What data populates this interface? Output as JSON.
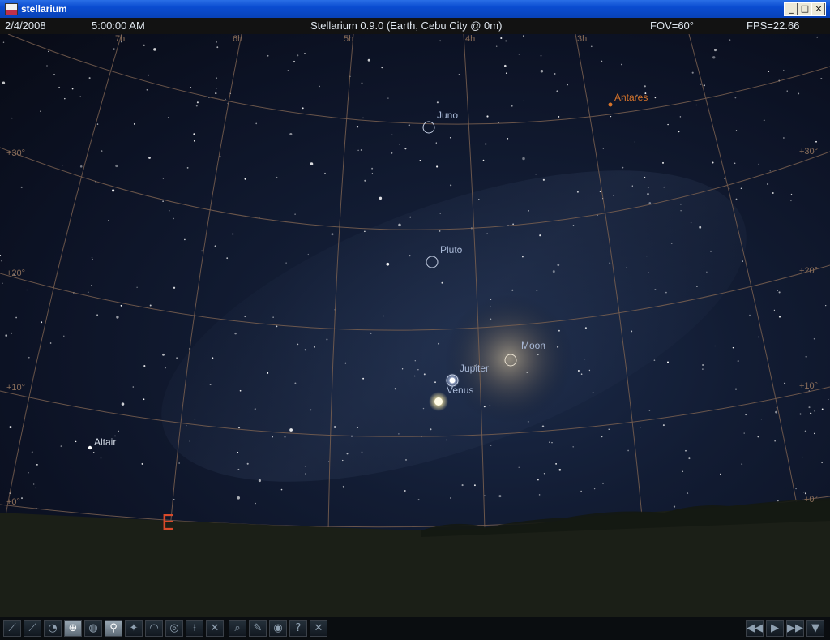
{
  "window": {
    "title": "stellarium"
  },
  "status": {
    "date": "2/4/2008",
    "time": "5:00:00 AM",
    "location": "Stellarium 0.9.0 (Earth, Cebu City @ 0m)",
    "fov": "FOV=60°",
    "fps": "FPS=22.66"
  },
  "sky": {
    "objects": {
      "juno": "Juno",
      "antares": "Antares",
      "pluto": "Pluto",
      "moon": "Moon",
      "jupiter": "Jupiter",
      "venus": "Venus",
      "altair": "Altair"
    },
    "cardinal_east": "E",
    "grid_labels": {
      "alt30_left": "+30°",
      "alt30_right": "+30°",
      "alt20_left": "+20°",
      "alt20_right": "+20°",
      "alt10_left": "+10°",
      "alt10_right": "+10°",
      "alt0_left": "+0°",
      "alt0_right": "+0°",
      "ra7": "7h",
      "ra6": "6h",
      "ra5": "5h",
      "ra4": "4h",
      "ra3": "3h"
    }
  },
  "toolbar": {
    "left": [
      {
        "name": "constellation-lines-button",
        "icon": "constellation-lines-icon",
        "glyph": "⟋"
      },
      {
        "name": "constellation-names-button",
        "icon": "constellation-names-icon",
        "glyph": "⟋"
      },
      {
        "name": "constellation-art-button",
        "icon": "constellation-art-icon",
        "glyph": "◔"
      },
      {
        "name": "equatorial-grid-button",
        "icon": "equatorial-grid-icon",
        "glyph": "⊕"
      },
      {
        "name": "azimuthal-grid-button",
        "icon": "azimuthal-grid-icon",
        "glyph": "◍"
      },
      {
        "name": "ground-button",
        "icon": "ground-icon",
        "glyph": "⚲"
      },
      {
        "name": "cardinal-points-button",
        "icon": "cardinal-points-icon",
        "glyph": "✦"
      },
      {
        "name": "atmosphere-button",
        "icon": "atmosphere-icon",
        "glyph": "◠"
      },
      {
        "name": "nebulas-button",
        "icon": "nebula-icon",
        "glyph": "◎"
      },
      {
        "name": "telescope-button",
        "icon": "telescope-icon",
        "glyph": "⟊"
      },
      {
        "name": "mount-mode-button",
        "icon": "mount-icon",
        "glyph": "✕"
      },
      {
        "name": "search-button",
        "icon": "search-icon",
        "glyph": "⌕"
      },
      {
        "name": "configuration-button",
        "icon": "wrench-icon",
        "glyph": "✎"
      },
      {
        "name": "night-mode-button",
        "icon": "eye-icon",
        "glyph": "◉"
      },
      {
        "name": "help-button",
        "icon": "help-icon",
        "glyph": "?"
      },
      {
        "name": "quit-button",
        "icon": "close-icon",
        "glyph": "✕"
      }
    ],
    "right": [
      {
        "name": "decrease-time-speed-button",
        "icon": "rewind-icon",
        "glyph": "◀◀"
      },
      {
        "name": "real-time-speed-button",
        "icon": "play-icon",
        "glyph": "▶"
      },
      {
        "name": "increase-time-speed-button",
        "icon": "fast-forward-icon",
        "glyph": "▶▶"
      },
      {
        "name": "return-to-current-time-button",
        "icon": "now-icon",
        "glyph": "▼"
      }
    ]
  },
  "colors": {
    "grid": "#7a6050",
    "antares": "#d8742a",
    "label": "#a8b8d6",
    "cardinal": "#d84a2a"
  }
}
